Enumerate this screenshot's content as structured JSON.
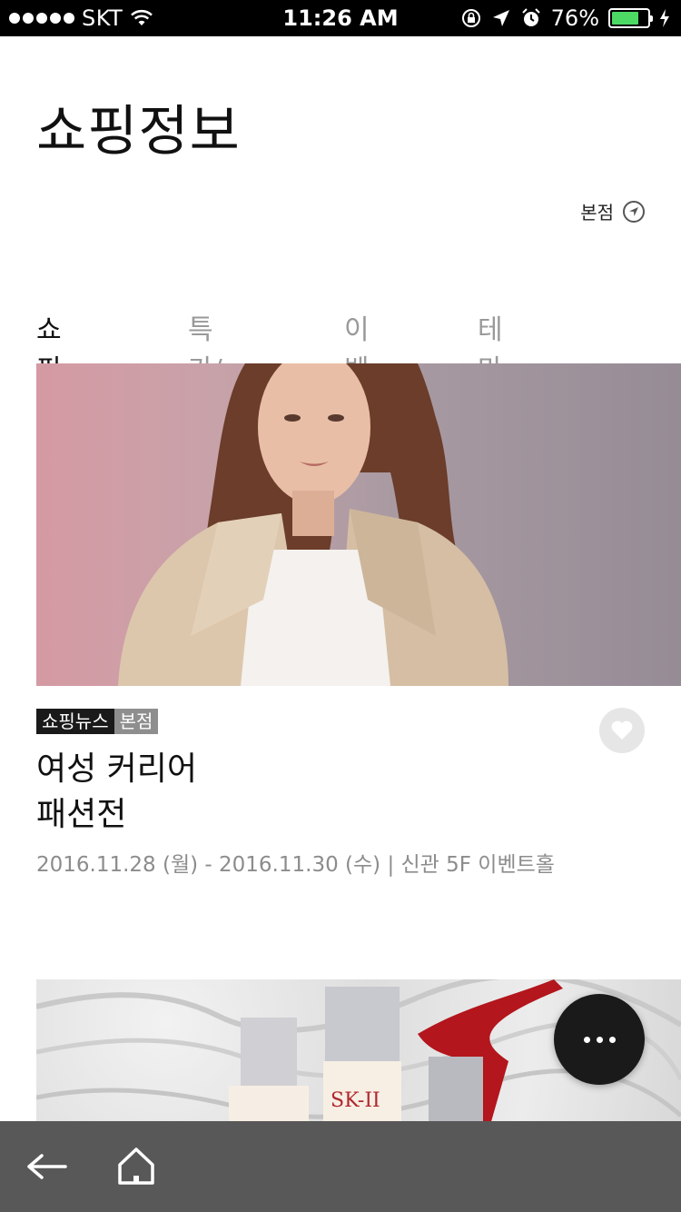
{
  "status_bar": {
    "carrier": "SKT",
    "time": "11:26 AM",
    "battery": "76%",
    "battery_level": 0.76
  },
  "header": {
    "title": "쇼핑정보",
    "branch_label": "본점"
  },
  "tabs": [
    {
      "label": "쇼핑뉴스",
      "active": true
    },
    {
      "label": "특가/쿠폰",
      "active": false
    },
    {
      "label": "이벤트",
      "active": false
    },
    {
      "label": "테마",
      "active": false
    }
  ],
  "article": {
    "tag_category": "쇼핑뉴스",
    "tag_branch": "본점",
    "title_line1": "여성 커리어",
    "title_line2": "패션전",
    "meta": "2016.11.28 (월) - 2016.11.30 (수) | 신관 5F 이벤트홀"
  },
  "second_card": {
    "brand_text": "SK-II"
  },
  "colors": {
    "status_bar": "#000000",
    "bottom_bar": "#585858",
    "fab": "#1a1a1a",
    "battery_fill": "#4cd964",
    "tag_dark": "#1a1a1a",
    "tag_grey": "#8e8e8e"
  },
  "icons": {
    "branch": "location-arrow-icon",
    "favorite": "heart-icon",
    "more": "more-dots-icon",
    "back": "back-arrow-icon",
    "home": "home-icon"
  }
}
